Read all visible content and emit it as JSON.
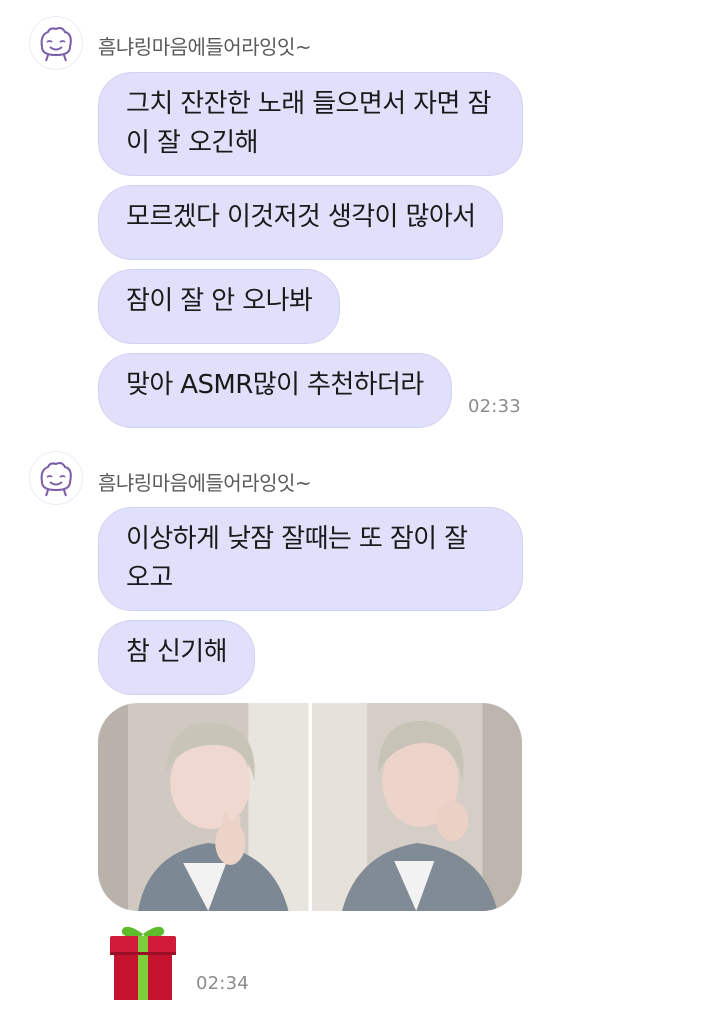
{
  "groups": [
    {
      "sender": "흠냐링마음에들어라잉잇~",
      "messages": [
        "그치 잔잔한 노래 들으면서 자면 잠이 잘 오긴해",
        "모르겠다 이것저것 생각이 많아서",
        "잠이 잘 안 오나봐",
        "맞아 ASMR많이 추천하더라"
      ],
      "time": "02:33"
    },
    {
      "sender": "흠냐링마음에들어라잉잇~",
      "messages": [
        "이상하게 낮잠 잘때는 또 잠이 잘 오고",
        "참 신기해"
      ],
      "photos": [
        "selfie-peace-sign",
        "selfie-finger-heart"
      ],
      "sticker": "gift-box-icon",
      "time": "02:34"
    }
  ],
  "colors": {
    "bubble": "#e1e0fb",
    "avatar_outline": "#7a5ca8"
  }
}
